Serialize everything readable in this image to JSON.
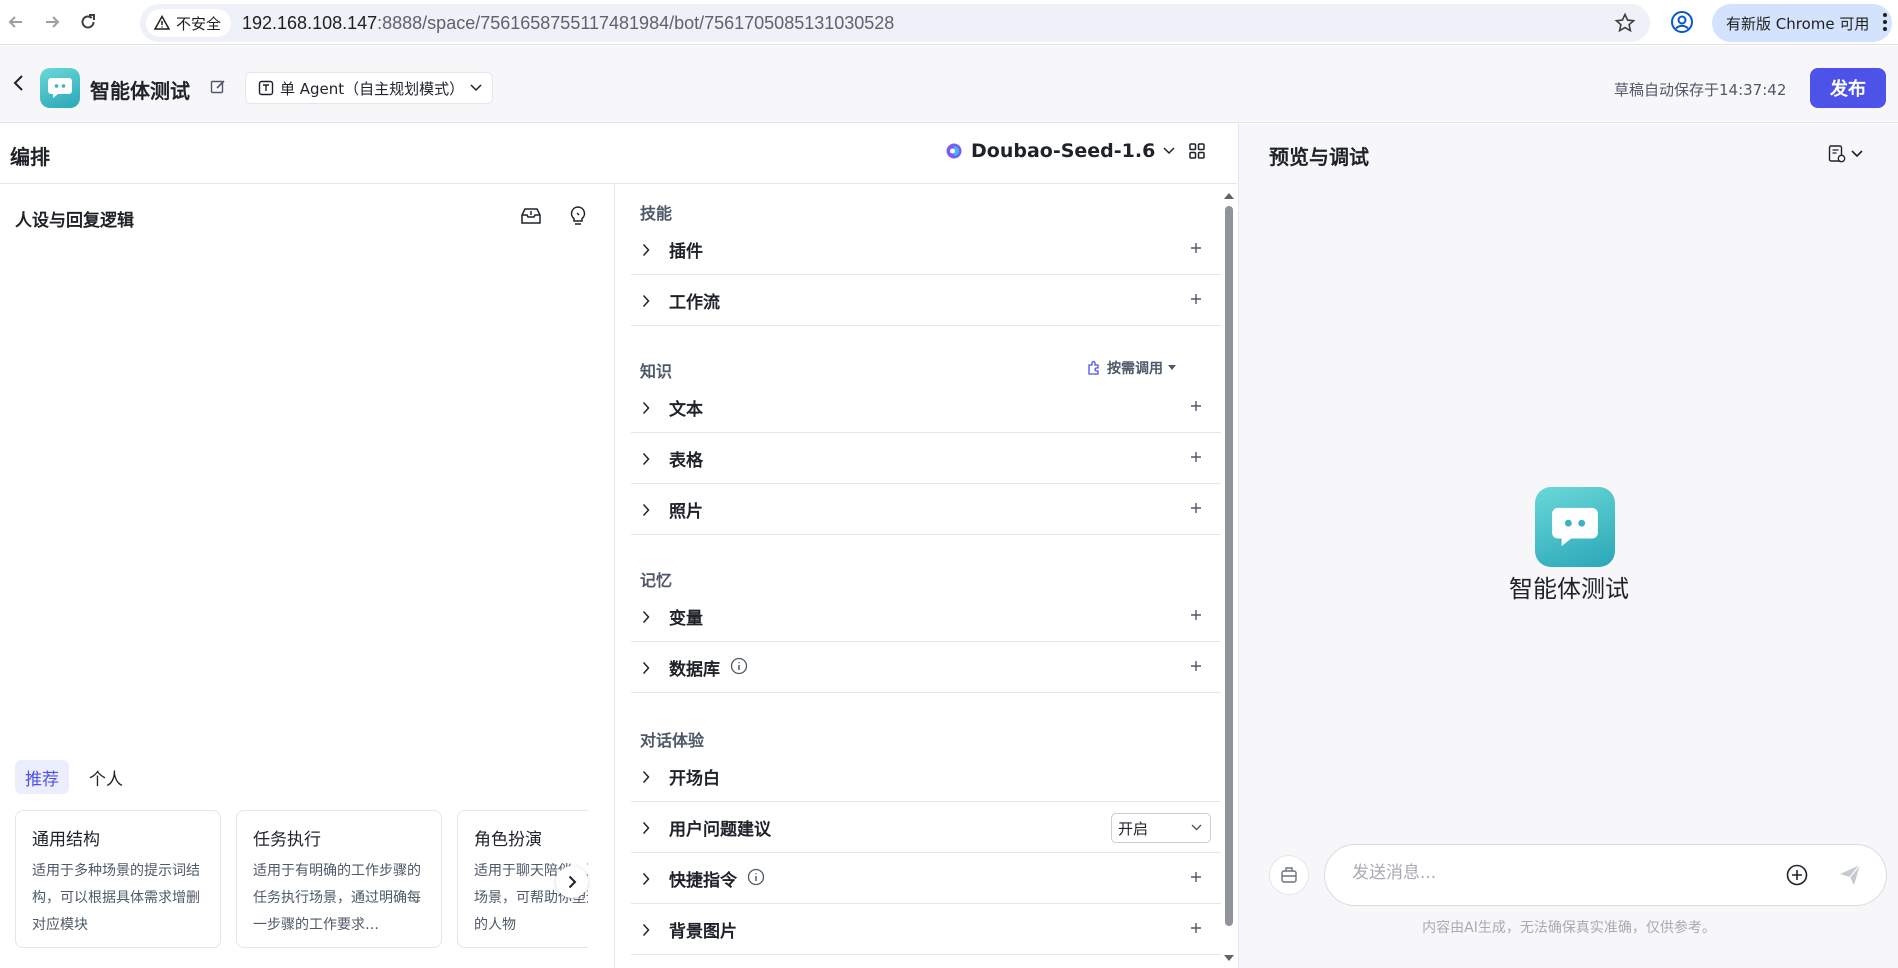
{
  "browser": {
    "security_label": "不安全",
    "url_host": "192.168.108.147",
    "url_rest": ":8888/space/7561658755117481984/bot/7561705085131030528",
    "update_label": "有新版 Chrome 可用"
  },
  "header": {
    "bot_name": "智能体测试",
    "mode_label": "单 Agent（自主规划模式）",
    "save_status": "草稿自动保存于14:37:42",
    "publish_label": "发布"
  },
  "editor": {
    "title": "编排",
    "model_name": "Doubao-Seed-1.6"
  },
  "persona": {
    "title": "人设与回复逻辑",
    "tabs": [
      {
        "label": "推荐",
        "active": true
      },
      {
        "label": "个人",
        "active": false
      }
    ],
    "cards": [
      {
        "title": "通用结构",
        "desc": "适用于多种场景的提示词结构，可以根据具体需求增删对应模块"
      },
      {
        "title": "任务执行",
        "desc": "适用于有明确的工作步骤的任务执行场景，通过明确每一步骤的工作要求…"
      },
      {
        "title": "角色扮演",
        "desc": "适用于聊天陪伴、互动娱乐场景，可帮助你塑造个性化的人物"
      }
    ]
  },
  "skills": {
    "sections": {
      "skill": "技能",
      "knowledge": "知识",
      "memory": "记忆",
      "dialog": "对话体验"
    },
    "knowledge_mode": "按需调用",
    "rows": {
      "plugin": "插件",
      "workflow": "工作流",
      "text": "文本",
      "table": "表格",
      "photo": "照片",
      "variable": "变量",
      "database": "数据库",
      "opening": "开场白",
      "suggest": "用户问题建议",
      "shortcut": "快捷指令",
      "background": "背景图片"
    },
    "suggest_value": "开启"
  },
  "preview": {
    "title": "预览与调试",
    "bot_name": "智能体测试",
    "input_placeholder": "发送消息...",
    "disclaimer": "内容由AI生成，无法确保真实准确，仅供参考。"
  }
}
